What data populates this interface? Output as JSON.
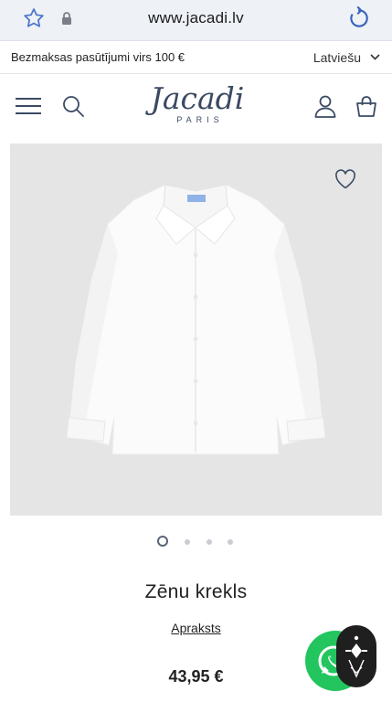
{
  "browser": {
    "url": "www.jacadi.lv",
    "icons": [
      "star-icon",
      "lock-icon",
      "reload-icon"
    ]
  },
  "promo": {
    "text": "Bezmaksas pasūtījumi virs 100 €",
    "language": "Latviešu"
  },
  "header": {
    "logo_word": "Jacadi",
    "logo_sub": "PARIS",
    "icons": [
      "menu-icon",
      "search-icon",
      "account-icon",
      "bag-icon"
    ]
  },
  "gallery": {
    "image_count": 4,
    "active_index": 1
  },
  "product": {
    "title": "Zēnu krekls",
    "description_link": "Apraksts",
    "price": "43,95 €"
  },
  "colors": {
    "brand": "#3b4a63",
    "image_bg": "#e5e5e5",
    "whatsapp": "#22c55e"
  }
}
